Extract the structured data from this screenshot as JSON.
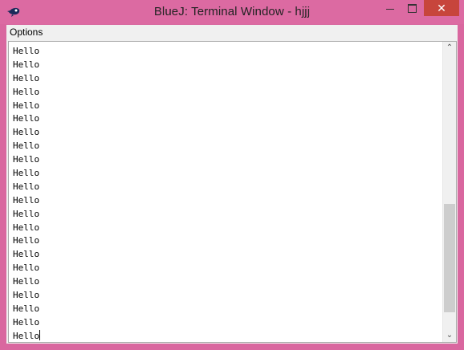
{
  "window": {
    "title": "BlueJ: Terminal Window - hjjj",
    "min_glyph": "",
    "max_glyph": "",
    "close_glyph": "✕"
  },
  "menubar": {
    "options_label": "Options"
  },
  "terminal": {
    "lines": [
      "Hello",
      "Hello",
      "Hello",
      "Hello",
      "Hello",
      "Hello",
      "Hello",
      "Hello",
      "Hello",
      "Hello",
      "Hello",
      "Hello",
      "Hello",
      "Hello",
      "Hello",
      "Hello",
      "Hello",
      "Hello",
      "Hello",
      "Hello",
      "Hello",
      "Hello"
    ]
  },
  "scrollbar": {
    "up_glyph": "⌃",
    "down_glyph": "⌄",
    "thumb_start_fraction": 0.545,
    "thumb_size_fraction": 0.395
  },
  "colors": {
    "frame": "#d9679f",
    "close_button": "#c7453c"
  }
}
